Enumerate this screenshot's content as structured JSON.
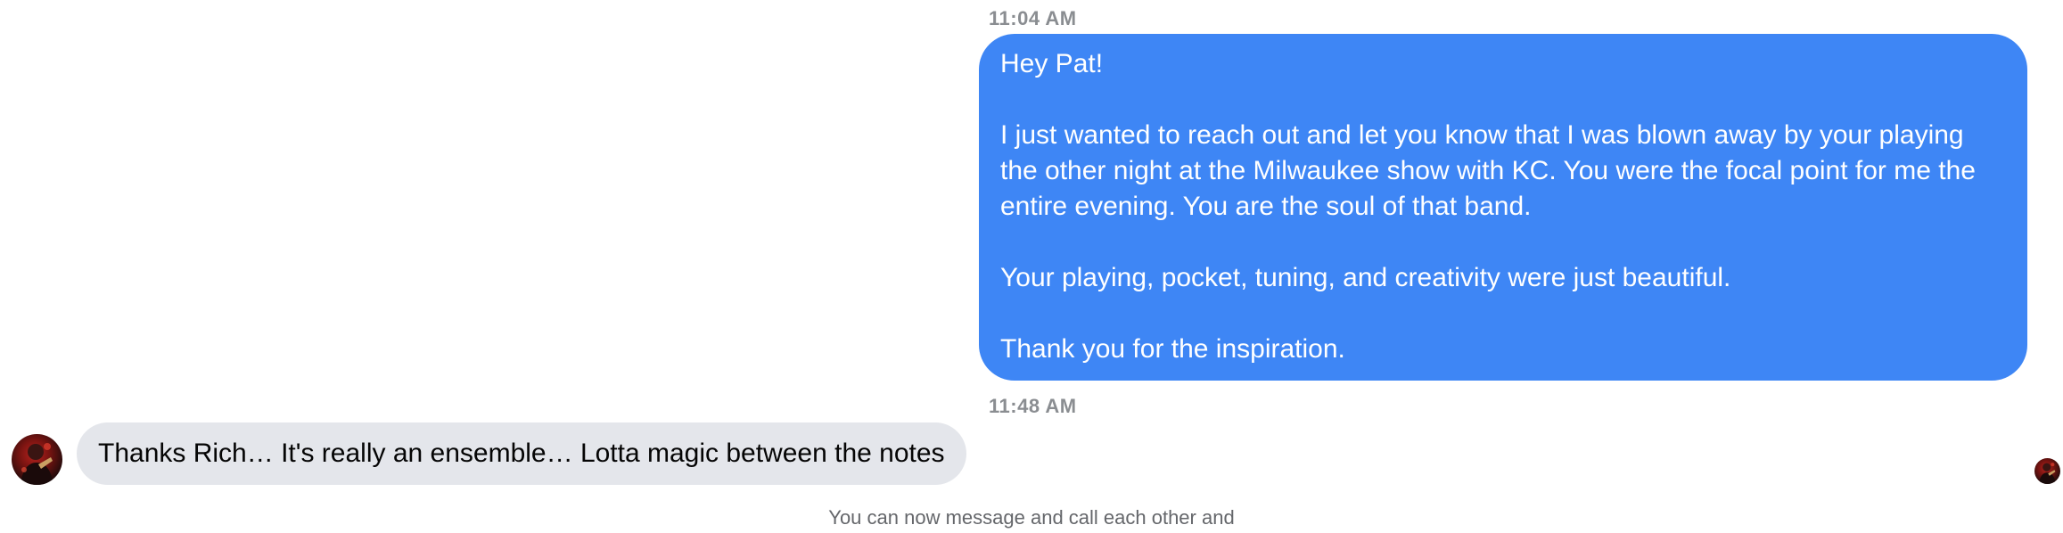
{
  "conversation": {
    "messages": [
      {
        "timestamp": "11:04 AM",
        "direction": "outgoing",
        "paragraphs": [
          "Hey Pat!",
          "I just wanted to reach out and let you know that I was blown away by your playing the other night at the Milwaukee show with KC. You were the focal point for me the entire evening. You are the soul of that band.",
          "Your playing, pocket, tuning, and creativity were just beautiful.",
          "Thank you for the inspiration."
        ]
      },
      {
        "timestamp": "11:48 AM",
        "direction": "incoming",
        "text": "Thanks Rich… It's really an ensemble… Lotta magic between the notes"
      }
    ],
    "system_note": "You can now message and call each other and"
  },
  "colors": {
    "outgoing_bubble": "#3e86f5",
    "incoming_bubble": "#e4e6eb",
    "timestamp_text": "#8a8d91",
    "system_text": "#65676b"
  },
  "icons": {
    "sender_avatar": "profile-photo-avatar",
    "read_receipt": "read-receipt-avatar"
  }
}
